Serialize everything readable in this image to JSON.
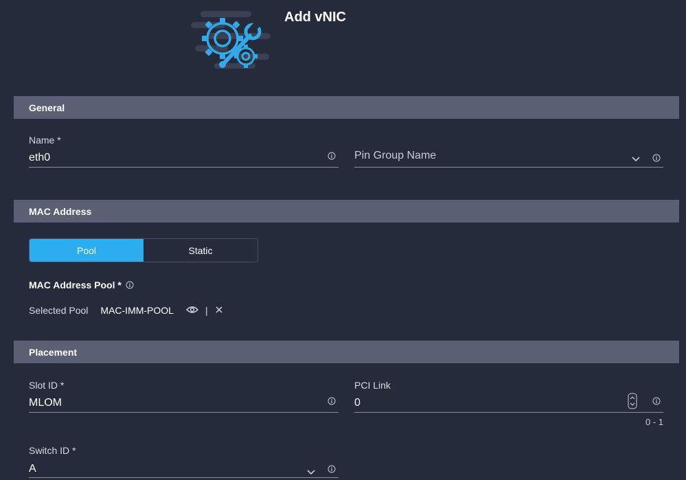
{
  "header": {
    "title": "Add vNIC",
    "illustration_icon": "gear-wrench-icon"
  },
  "general": {
    "section_title": "General",
    "name": {
      "label": "Name *",
      "value": "eth0"
    },
    "pin_group": {
      "placeholder": "Pin Group Name"
    }
  },
  "mac": {
    "section_title": "MAC Address",
    "toggle": {
      "pool_label": "Pool",
      "static_label": "Static",
      "selected": "Pool"
    },
    "pool": {
      "label": "MAC Address Pool *",
      "selected_label": "Selected Pool",
      "selected_value": "MAC-IMM-POOL",
      "separator": "|"
    }
  },
  "placement": {
    "section_title": "Placement",
    "slot_id": {
      "label": "Slot ID *",
      "value": "MLOM"
    },
    "pci_link": {
      "label": "PCI Link",
      "value": "0",
      "range": "0 - 1"
    },
    "switch_id": {
      "label": "Switch ID *",
      "value": "A"
    }
  },
  "colors": {
    "accent": "#2aaef0",
    "background": "#252b3a",
    "section_bar": "#5b6172"
  }
}
